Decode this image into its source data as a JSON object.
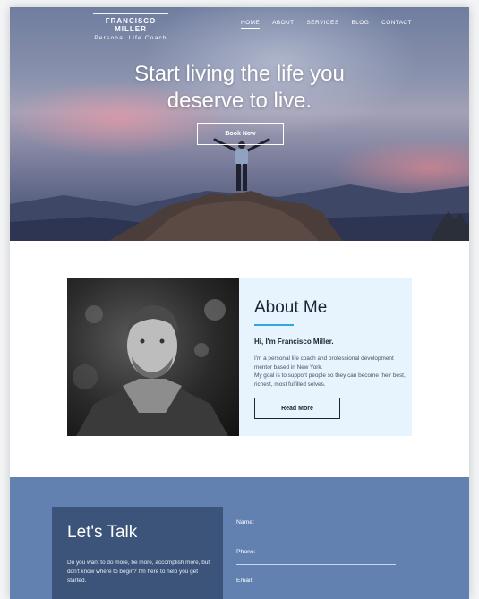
{
  "brand": {
    "name": "FRANCISCO MILLER",
    "tagline": "Personal Life Coach"
  },
  "nav": {
    "items": [
      {
        "label": "HOME",
        "active": true
      },
      {
        "label": "ABOUT",
        "active": false
      },
      {
        "label": "SERVICES",
        "active": false
      },
      {
        "label": "BLOG",
        "active": false
      },
      {
        "label": "CONTACT",
        "active": false
      }
    ]
  },
  "hero": {
    "title_line1": "Start living the life you",
    "title_line2": "deserve to live.",
    "cta_label": "Book Now"
  },
  "about": {
    "title": "About Me",
    "greeting": "Hi, I'm Francisco Miller.",
    "text1": "I'm a personal life coach and professional development mentor based in New York.",
    "text2": "My goal is to support people so they can become their best, richest, most fulfilled selves.",
    "button_label": "Read More"
  },
  "contact": {
    "title": "Let's Talk",
    "text": "Do you want to do more, be more, accomplish more, but don't know where to begin? I'm here to help you get started.",
    "fields": {
      "name": "Name:",
      "phone": "Phone:",
      "email": "Email:"
    }
  },
  "colors": {
    "accent": "#32a6de",
    "contact_bg": "#6281b1",
    "talk_box_bg": "#3c5479",
    "about_card_bg": "#e7f3fd"
  }
}
